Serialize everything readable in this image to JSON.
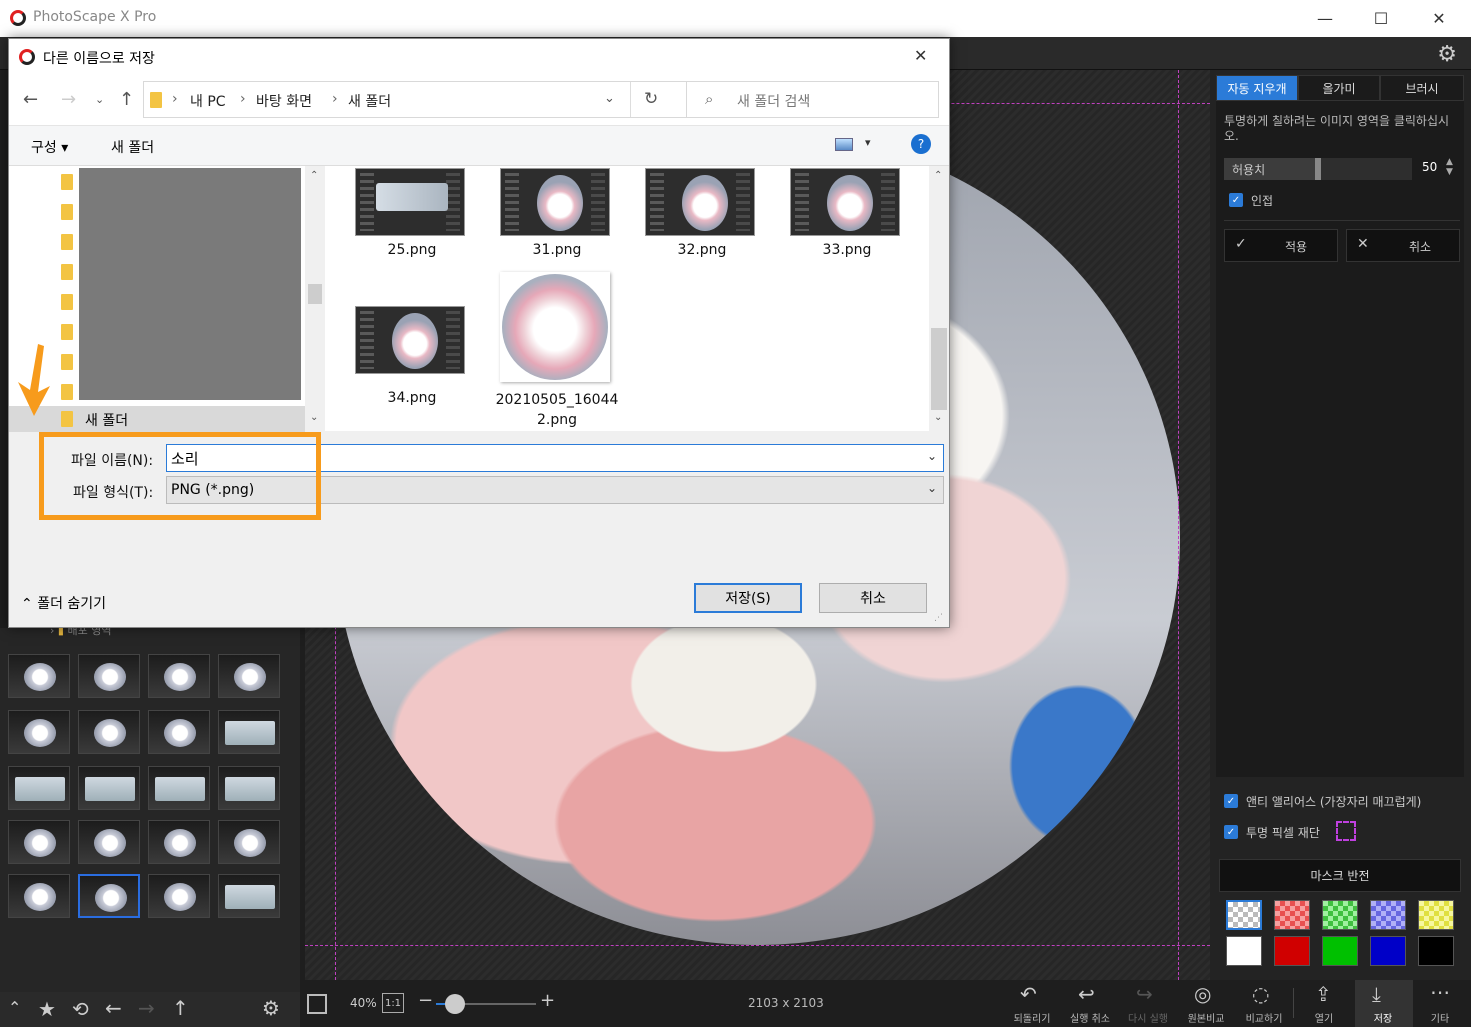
{
  "app": {
    "title": "PhotoScape X Pro",
    "window_controls": {
      "minimize": "—",
      "maximize": "☐",
      "close": "✕"
    }
  },
  "canvas": {
    "image_size": "2103 x 2103"
  },
  "right_panel": {
    "tabs": [
      {
        "label": "자동 지우개",
        "active": true
      },
      {
        "label": "올가미",
        "active": false
      },
      {
        "label": "브러시",
        "active": false
      }
    ],
    "instruction": "투명하게 칠하려는 이미지 영역을 클릭하십시오.",
    "tolerance_label": "허용치",
    "tolerance_value": "50",
    "adjacent_label": "인접",
    "apply_label": "적용",
    "cancel_label": "취소",
    "antialias_label": "앤티 앨리어스 (가장자리 매끄럽게)",
    "transparent_crop_label": "투명 픽셀 재단",
    "invert_mask_label": "마스크 반전",
    "swatch_colors": [
      "checker",
      "#e85050",
      "#40c040",
      "#6666e0",
      "#e0e040",
      "#ffffff",
      "#d00000",
      "#00c000",
      "#0000c8",
      "#000000"
    ]
  },
  "left_panel": {
    "folder_label": "배포 영역"
  },
  "bottom_bar": {
    "zoom_percent": "40%",
    "one_to_one": "1:1",
    "actions": [
      {
        "label": "되돌리기",
        "icon": "revert-icon"
      },
      {
        "label": "실행 취소",
        "icon": "undo-icon"
      },
      {
        "label": "다시 실행",
        "icon": "redo-icon"
      },
      {
        "label": "원본비교",
        "icon": "compare-original-icon"
      },
      {
        "label": "비교하기",
        "icon": "compare-icon"
      },
      {
        "label": "열기",
        "icon": "open-icon"
      },
      {
        "label": "저장",
        "icon": "save-icon"
      },
      {
        "label": "기타",
        "icon": "more-icon"
      }
    ]
  },
  "dialog": {
    "title": "다른 이름으로 저장",
    "close": "✕",
    "breadcrumb": [
      "내 PC",
      "바탕 화면",
      "새 폴더"
    ],
    "search_placeholder": "새 폴더 검색",
    "organize_label": "구성 ▾",
    "new_folder_label": "새 폴더",
    "help": "?",
    "tree_selected": "새 폴더",
    "files": [
      {
        "name": "25.png"
      },
      {
        "name": "31.png"
      },
      {
        "name": "32.png"
      },
      {
        "name": "33.png"
      },
      {
        "name": "34.png"
      },
      {
        "name": "20210505_16044",
        "name2": "2.png"
      }
    ],
    "filename_label": "파일 이름(N):",
    "filename_value": "소리",
    "filetype_label": "파일 형식(T):",
    "filetype_value": "PNG (*.png)",
    "hide_folders_label": "폴더 숨기기",
    "save_button": "저장(S)",
    "cancel_button": "취소"
  }
}
